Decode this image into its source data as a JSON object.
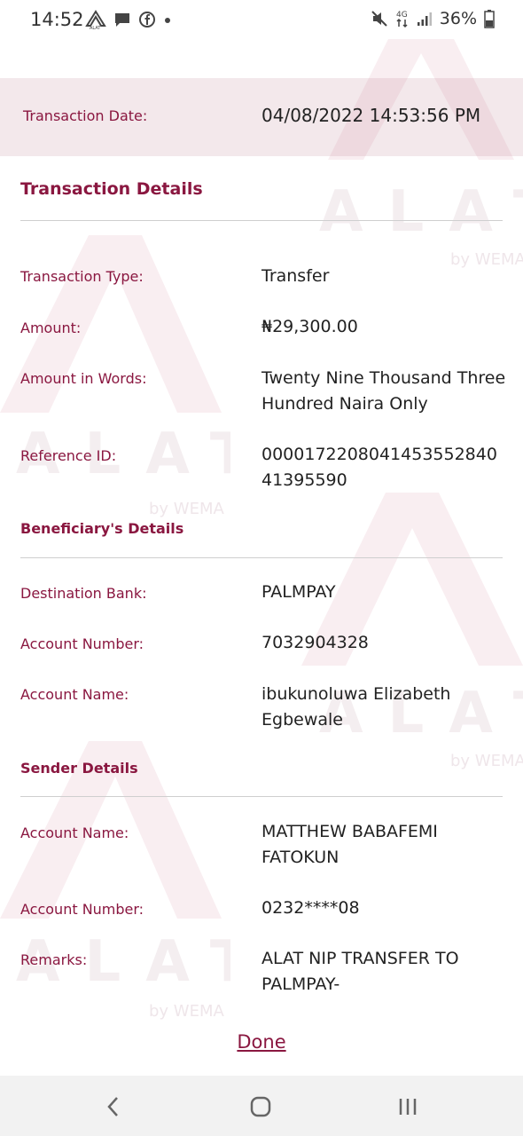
{
  "status_bar": {
    "time": "14:52",
    "battery": "36%",
    "network": "4G"
  },
  "watermark": {
    "brand": "ALAT",
    "sub": "by WEMA"
  },
  "header": {
    "date_label": "Transaction Date:",
    "date_value": "04/08/2022 14:53:56 PM"
  },
  "transaction_details": {
    "title": "Transaction Details",
    "rows": [
      {
        "label": "Transaction Type:",
        "value": "Transfer"
      },
      {
        "label": "Amount:",
        "value": "₦29,300.00"
      },
      {
        "label": "Amount in Words:",
        "value": "Twenty Nine Thousand Three Hundred  Naira Only"
      },
      {
        "label": "Reference ID:",
        "value": "000017220804145355284041395590"
      }
    ]
  },
  "beneficiary_details": {
    "title": "Beneficiary's Details",
    "rows": [
      {
        "label": "Destination Bank:",
        "value": "PALMPAY"
      },
      {
        "label": "Account Number:",
        "value": "7032904328"
      },
      {
        "label": "Account Name:",
        "value": "ibukunoluwa Elizabeth Egbewale"
      }
    ]
  },
  "sender_details": {
    "title": "Sender Details",
    "rows": [
      {
        "label": "Account Name:",
        "value": "MATTHEW BABAFEMI FATOKUN"
      },
      {
        "label": "Account Number:",
        "value": "0232****08"
      },
      {
        "label": "Remarks:",
        "value": "ALAT NIP TRANSFER TO PALMPAY-"
      }
    ]
  },
  "done_label": "Done",
  "colors": {
    "accent": "#8a1740",
    "band": "#f0e4e8"
  }
}
